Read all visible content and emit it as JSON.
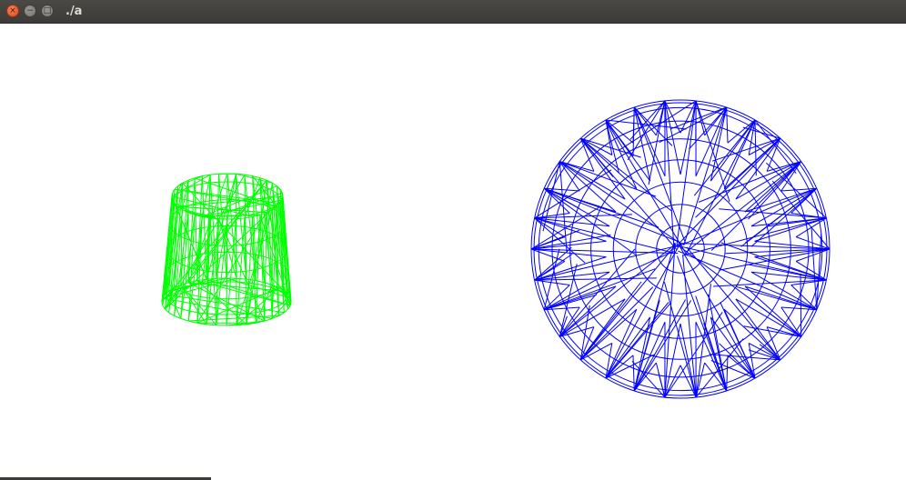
{
  "window": {
    "title": "./a",
    "controls": {
      "close_glyph": "×",
      "minimize_glyph": "−",
      "maximize_glyph": "□"
    }
  },
  "scene": {
    "background": "#ffffff",
    "objects": [
      {
        "name": "cylinder-wireframe",
        "color": "#00ff00"
      },
      {
        "name": "sphere-wireframe",
        "color": "#0000ff"
      }
    ]
  }
}
